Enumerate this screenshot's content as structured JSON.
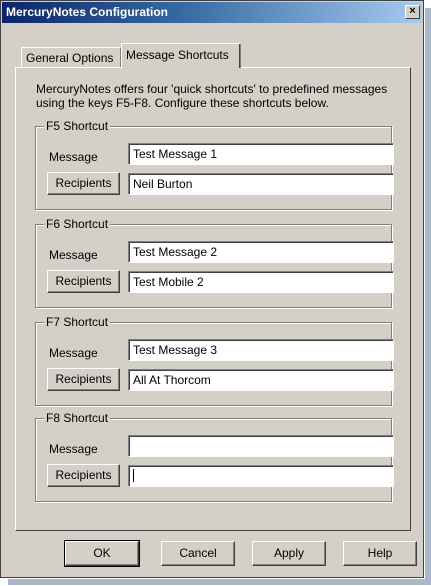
{
  "window": {
    "title": "MercuryNotes Configuration",
    "close_label": "×"
  },
  "tabs": [
    {
      "label": "General Options",
      "active": false
    },
    {
      "label": "Message Shortcuts",
      "active": true
    }
  ],
  "intro_text": "MercuryNotes offers four 'quick shortcuts' to predefined messages using the keys F5-F8. Configure these shortcuts below.",
  "shortcuts": [
    {
      "legend": "F5 Shortcut",
      "message_label": "Message",
      "message": "Test Message 1",
      "recipients_button": "Recipients",
      "recipients": "Neil Burton"
    },
    {
      "legend": "F6 Shortcut",
      "message_label": "Message",
      "message": "Test Message 2",
      "recipients_button": "Recipients",
      "recipients": "Test Mobile 2"
    },
    {
      "legend": "F7 Shortcut",
      "message_label": "Message",
      "message": "Test Message 3",
      "recipients_button": "Recipients",
      "recipients": "All At Thorcom"
    },
    {
      "legend": "F8 Shortcut",
      "message_label": "Message",
      "message": "",
      "recipients_button": "Recipients",
      "recipients": ""
    }
  ],
  "buttons": {
    "ok": "OK",
    "cancel": "Cancel",
    "apply": "Apply",
    "help": "Help"
  },
  "colors": {
    "title_start": "#0a246a",
    "title_end": "#a6caf0",
    "face": "#d4d0c8"
  }
}
